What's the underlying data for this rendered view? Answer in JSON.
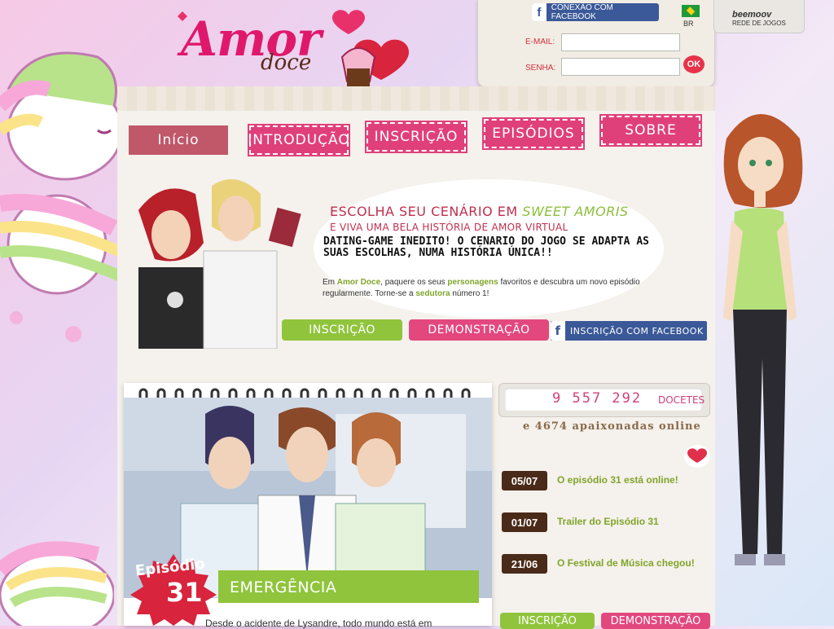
{
  "logo": {
    "amor": "Amor",
    "doce": "doce"
  },
  "login": {
    "facebook_label": "CONEXÃO COM FACEBOOK",
    "email_label": "E-MAIL:",
    "password_label": "SENHA:",
    "ok_label": "OK",
    "lang_label": "BR"
  },
  "beemoov": {
    "logo": "beemoov",
    "subtitle": "REDE DE JOGOS"
  },
  "nav": {
    "items": [
      {
        "label": "Início"
      },
      {
        "label": "INTRODUÇÃO"
      },
      {
        "label": "INSCRIÇÃO"
      },
      {
        "label": "EPISÓDIOS"
      },
      {
        "label": "SOBRE"
      }
    ]
  },
  "hero": {
    "title_prefix": "ESCOLHA SEU CENÁRIO EM",
    "title_highlight": "SWEET AMORIS",
    "subtitle": "E VIVA UMA BELA HISTÓRIA DE AMOR VIRTUAL",
    "bold_text": "DATING-GAME INEDITO! O CENARIO DO JOGO SE ADAPTA AS SUAS ESCOLHAS, NUMA HISTÓRIA ÚNICA!!",
    "desc": {
      "p1": "Em",
      "b1": "Amor Doce",
      "p2": ", paquere os seus",
      "b2": "personagens",
      "p3": "favoritos e descubra um novo episódio regularmente. Torne-se a",
      "b3": "sedutora",
      "p4": "número 1!"
    },
    "btn_signup": "INSCRIÇÃO",
    "btn_demo": "DEMONSTRAÇÃO",
    "btn_fb": "INSCRIÇÃO COM FACEBOOK"
  },
  "episode": {
    "label": "Episódio",
    "number": "31",
    "title": "EMERGÊNCIA",
    "text": "Desde o acidente de Lysandre, todo mundo está em"
  },
  "counter": {
    "value": "9 557 292",
    "unit": "DOCETES",
    "online": "e 4674 apaixonadas online"
  },
  "news": [
    {
      "date": "05/07",
      "text": "O episódio 31 está online!"
    },
    {
      "date": "01/07",
      "text": "Trailer do Episódio 31"
    },
    {
      "date": "21/06",
      "text": "O Festival de Música chegou!"
    }
  ],
  "bottom": {
    "signup": "INSCRIÇÃO",
    "demo": "DEMONSTRAÇÃO"
  },
  "colors": {
    "pink": "#e0407a",
    "green": "#8fc43c",
    "facebook": "#3b5998",
    "brown": "#4a2a18"
  }
}
